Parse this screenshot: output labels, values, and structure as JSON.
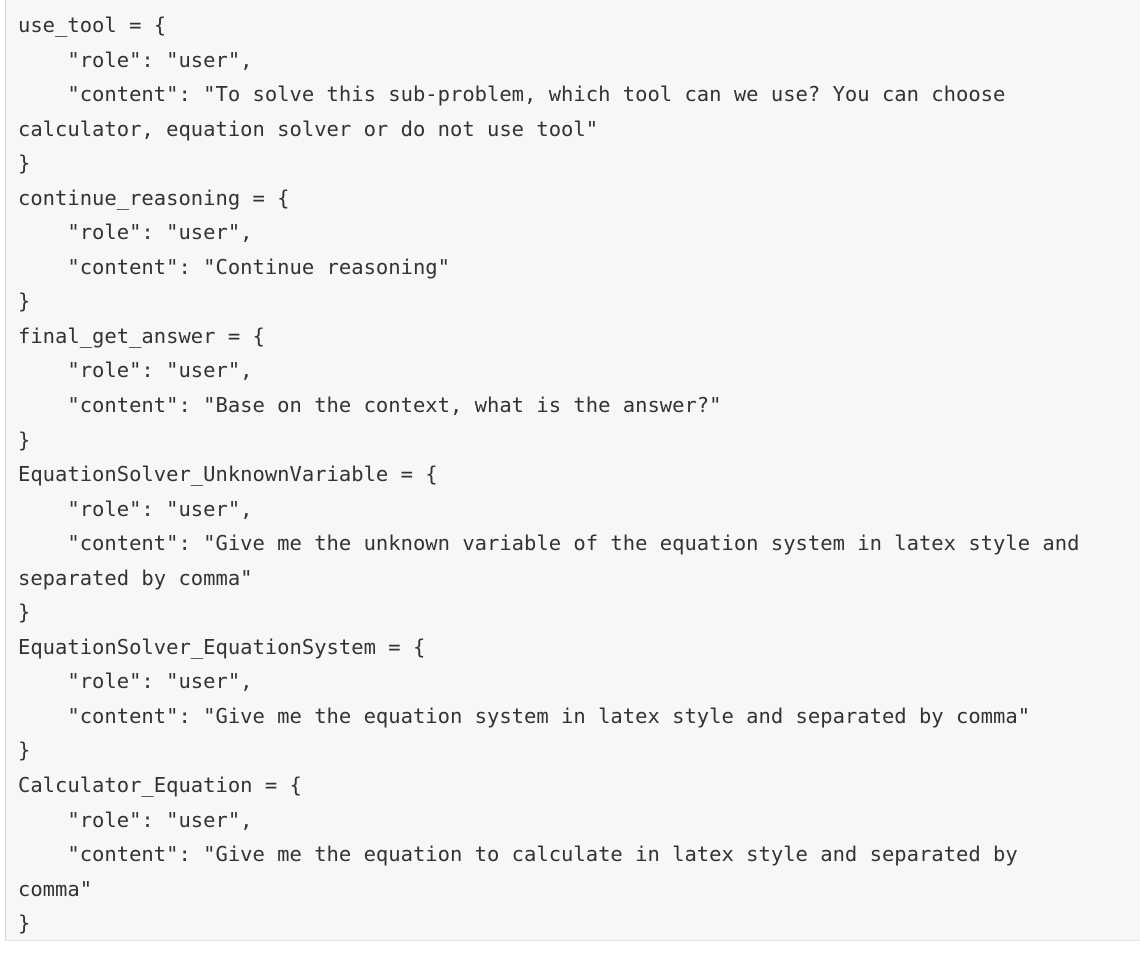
{
  "code": {
    "lines": [
      "use_tool = {",
      "    \"role\": \"user\",",
      "    \"content\": \"To solve this sub-problem, which tool can we use? You can choose",
      "calculator, equation solver or do not use tool\"",
      "}",
      "continue_reasoning = {",
      "    \"role\": \"user\",",
      "    \"content\": \"Continue reasoning\"",
      "}",
      "final_get_answer = {",
      "    \"role\": \"user\",",
      "    \"content\": \"Base on the context, what is the answer?\"",
      "}",
      "EquationSolver_UnknownVariable = {",
      "    \"role\": \"user\",",
      "    \"content\": \"Give me the unknown variable of the equation system in latex style and",
      "separated by comma\"",
      "}",
      "EquationSolver_EquationSystem = {",
      "    \"role\": \"user\",",
      "    \"content\": \"Give me the equation system in latex style and separated by comma\"",
      "}",
      "Calculator_Equation = {",
      "    \"role\": \"user\",",
      "    \"content\": \"Give me the equation to calculate in latex style and separated by",
      "comma\"",
      "}"
    ]
  }
}
